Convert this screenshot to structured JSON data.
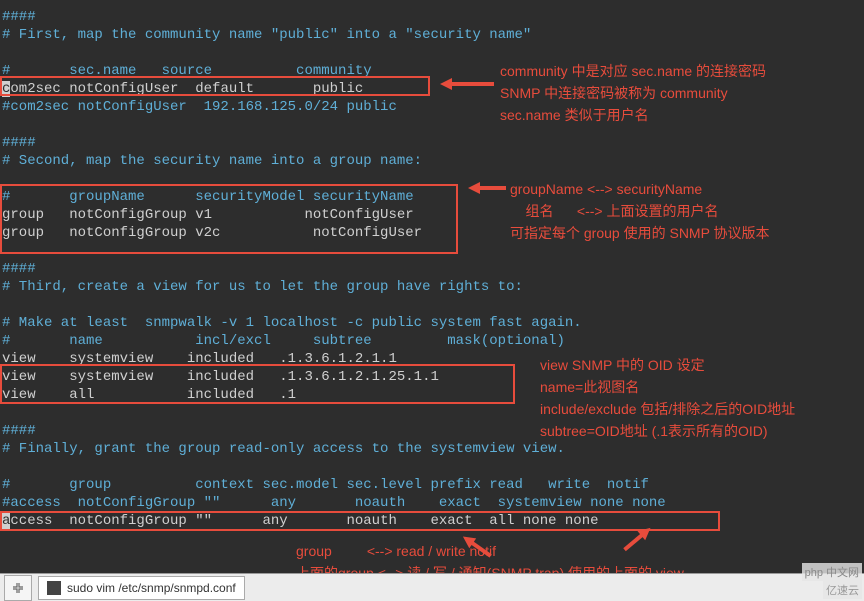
{
  "terminal": {
    "lines": [
      "####",
      "# First, map the community name \"public\" into a \"security name\"",
      "",
      "#       sec.name   source          community",
      "com2sec notConfigUser  default       public",
      "#com2sec notConfigUser  192.168.125.0/24 public",
      "",
      "####",
      "# Second, map the security name into a group name:",
      "",
      "#       groupName      securityModel securityName",
      "group   notConfigGroup v1           notConfigUser",
      "group   notConfigGroup v2c           notConfigUser",
      "",
      "####",
      "# Third, create a view for us to let the group have rights to:",
      "",
      "# Make at least  snmpwalk -v 1 localhost -c public system fast again.",
      "#       name           incl/excl     subtree         mask(optional)",
      "view    systemview    included   .1.3.6.1.2.1.1",
      "view    systemview    included   .1.3.6.1.2.1.25.1.1",
      "view    all           included   .1",
      "",
      "####",
      "# Finally, grant the group read-only access to the systemview view.",
      "",
      "#       group          context sec.model sec.level prefix read   write  notif",
      "#access  notConfigGroup \"\"      any       noauth    exact  systemview none none",
      "access  notConfigGroup \"\"      any       noauth    exact  all none none"
    ]
  },
  "annotations": {
    "block1": {
      "l1": "community 中是对应 sec.name 的连接密码",
      "l2": "SNMP 中连接密码被称为 community",
      "l3": "sec.name 类似于用户名"
    },
    "block2": {
      "l1": "groupName <--> securityName",
      "l2": "    组名      <--> 上面设置的用户名",
      "l3": "可指定每个 group 使用的 SNMP 协议版本"
    },
    "block3": {
      "l1": "view SNMP 中的 OID 设定",
      "l2": "name=此视图名",
      "l3": "include/exclude 包括/排除之后的OID地址",
      "l4": "subtree=OID地址 (.1表示所有的OID)"
    },
    "block4": {
      "l1": "group         <--> read / write notif",
      "l2": "上面的group <--> 读 / 写 / 通知(SNMP trap) 使用的上面的 view"
    }
  },
  "bottombar": {
    "command": "sudo vim /etc/snmp/snmpd.conf"
  },
  "logos": {
    "l1": "php 中文网",
    "l2": "亿速云"
  }
}
